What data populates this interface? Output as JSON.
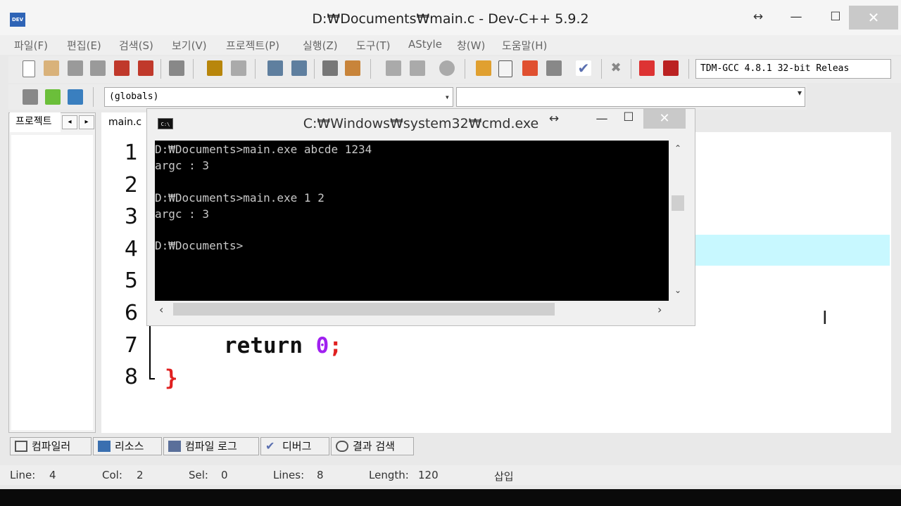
{
  "window": {
    "title": "D:₩Documents₩main.c - Dev-C++ 5.9.2",
    "min": "—",
    "max": "☐",
    "close": "✕",
    "resize": "↔"
  },
  "menu": [
    "파일(F)",
    "편집(E)",
    "검색(S)",
    "보기(V)",
    "프로젝트(P)",
    "실행(Z)",
    "도구(T)",
    "AStyle",
    "창(W)",
    "도움말(H)"
  ],
  "toolbar": {
    "compiler": "TDM-GCC 4.8.1 32-bit Releas",
    "globals": "(globals)",
    "function": ""
  },
  "left_panel": {
    "tab": "프로젝트",
    "prev": "◂",
    "next": "▸"
  },
  "editor": {
    "file_tab": "main.c",
    "line_numbers": [
      "1",
      "2",
      "3",
      "4",
      "5",
      "6",
      "7",
      "8"
    ],
    "line7_keyword": "return ",
    "line7_number": "0",
    "line7_semicolon": ";",
    "line8": "}"
  },
  "cmd": {
    "title": "C:₩Windows₩system32₩cmd.exe",
    "icon": "C:\\",
    "lines": [
      "D:₩Documents>main.exe abcde 1234",
      "argc : 3",
      "",
      "D:₩Documents>main.exe 1 2",
      "argc : 3",
      "",
      "D:₩Documents>"
    ]
  },
  "bottom_tabs": [
    "컴파일러",
    "리소스",
    "컴파일 로그",
    "디버그",
    "결과 검색"
  ],
  "status": {
    "line_label": "Line:",
    "line": "4",
    "col_label": "Col:",
    "col": "2",
    "sel_label": "Sel:",
    "sel": "0",
    "lines_label": "Lines:",
    "lines": "8",
    "length_label": "Length:",
    "length": "120",
    "mode": "삽입"
  },
  "colors": {
    "highlight_line": "#c8f8ff",
    "number": "#a020f0",
    "brace": "#e02020"
  }
}
